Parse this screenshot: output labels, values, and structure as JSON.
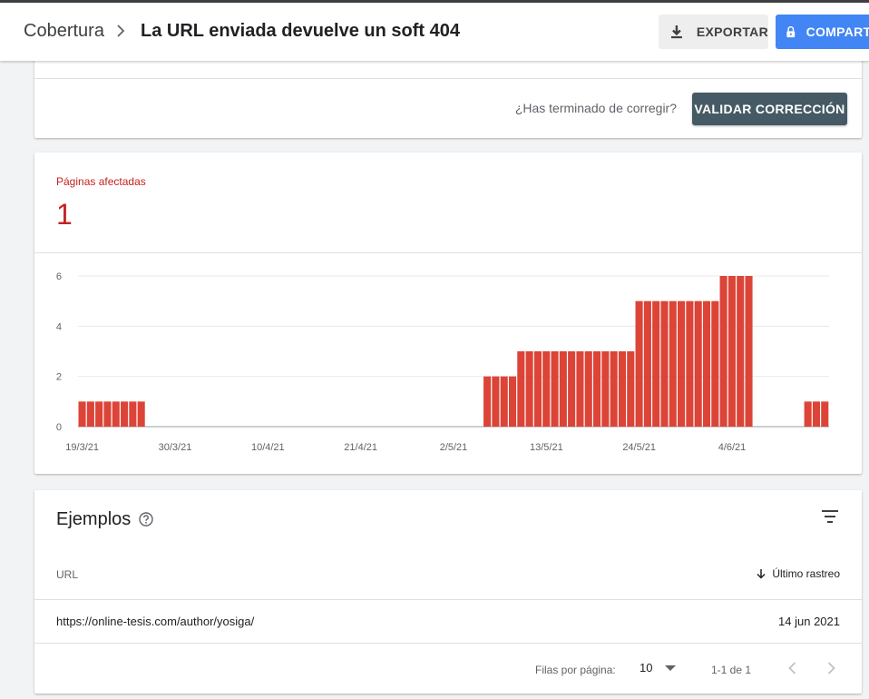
{
  "header": {
    "breadcrumb_root": "Cobertura",
    "title": "La URL enviada devuelve un soft 404",
    "export_label": "EXPORTAR",
    "share_label": "COMPARTIR"
  },
  "validation": {
    "question": "¿Has terminado de corregir?",
    "button_label": "VALIDAR CORRECCIÓN"
  },
  "metric": {
    "label": "Páginas afectadas",
    "value": "1"
  },
  "chart_data": {
    "type": "bar",
    "color": "#db4437",
    "ylim": [
      0,
      6
    ],
    "yticks": [
      0,
      2,
      4,
      6
    ],
    "x_tick_labels": [
      "19/3/21",
      "30/3/21",
      "10/4/21",
      "21/4/21",
      "2/5/21",
      "13/5/21",
      "24/5/21",
      "4/6/21"
    ],
    "dates": [
      "19/3/21",
      "20/3/21",
      "21/3/21",
      "22/3/21",
      "23/3/21",
      "24/3/21",
      "25/3/21",
      "26/3/21",
      "27/3/21",
      "28/3/21",
      "29/3/21",
      "30/3/21",
      "31/3/21",
      "1/4/21",
      "2/4/21",
      "3/4/21",
      "4/4/21",
      "5/4/21",
      "6/4/21",
      "7/4/21",
      "8/4/21",
      "9/4/21",
      "10/4/21",
      "11/4/21",
      "12/4/21",
      "13/4/21",
      "14/4/21",
      "15/4/21",
      "16/4/21",
      "17/4/21",
      "18/4/21",
      "19/4/21",
      "20/4/21",
      "21/4/21",
      "22/4/21",
      "23/4/21",
      "24/4/21",
      "25/4/21",
      "26/4/21",
      "27/4/21",
      "28/4/21",
      "29/4/21",
      "30/4/21",
      "1/5/21",
      "2/5/21",
      "3/5/21",
      "4/5/21",
      "5/5/21",
      "6/5/21",
      "7/5/21",
      "8/5/21",
      "9/5/21",
      "10/5/21",
      "11/5/21",
      "12/5/21",
      "13/5/21",
      "14/5/21",
      "15/5/21",
      "16/5/21",
      "17/5/21",
      "18/5/21",
      "19/5/21",
      "20/5/21",
      "21/5/21",
      "22/5/21",
      "23/5/21",
      "24/5/21",
      "25/5/21",
      "26/5/21",
      "27/5/21",
      "28/5/21",
      "29/5/21",
      "30/5/21",
      "31/5/21",
      "1/6/21",
      "2/6/21",
      "3/6/21",
      "4/6/21",
      "5/6/21",
      "6/6/21",
      "7/6/21",
      "8/6/21",
      "9/6/21",
      "10/6/21",
      "11/6/21",
      "12/6/21",
      "13/6/21",
      "14/6/21"
    ],
    "values": [
      1,
      1,
      1,
      1,
      1,
      1,
      1,
      1,
      0,
      0,
      0,
      0,
      0,
      0,
      0,
      0,
      0,
      0,
      0,
      0,
      0,
      0,
      0,
      0,
      0,
      0,
      0,
      0,
      0,
      0,
      0,
      0,
      0,
      0,
      0,
      0,
      0,
      0,
      0,
      0,
      0,
      0,
      0,
      0,
      0,
      0,
      0,
      0,
      2,
      2,
      2,
      2,
      3,
      3,
      3,
      3,
      3,
      3,
      3,
      3,
      3,
      3,
      3,
      3,
      3,
      3,
      5,
      5,
      5,
      5,
      5,
      5,
      5,
      5,
      5,
      5,
      6,
      6,
      6,
      6,
      0,
      0,
      0,
      0,
      0,
      0,
      1,
      1,
      1
    ]
  },
  "examples": {
    "title": "Ejemplos",
    "col_url": "URL",
    "col_date": "Último rastreo",
    "rows": [
      {
        "url": "https://online-tesis.com/author/yosiga/",
        "date": "14 jun 2021"
      }
    ],
    "pagination": {
      "rows_per_page_label": "Filas por página:",
      "rows_per_page": "10",
      "range": "1-1 de 1"
    }
  }
}
